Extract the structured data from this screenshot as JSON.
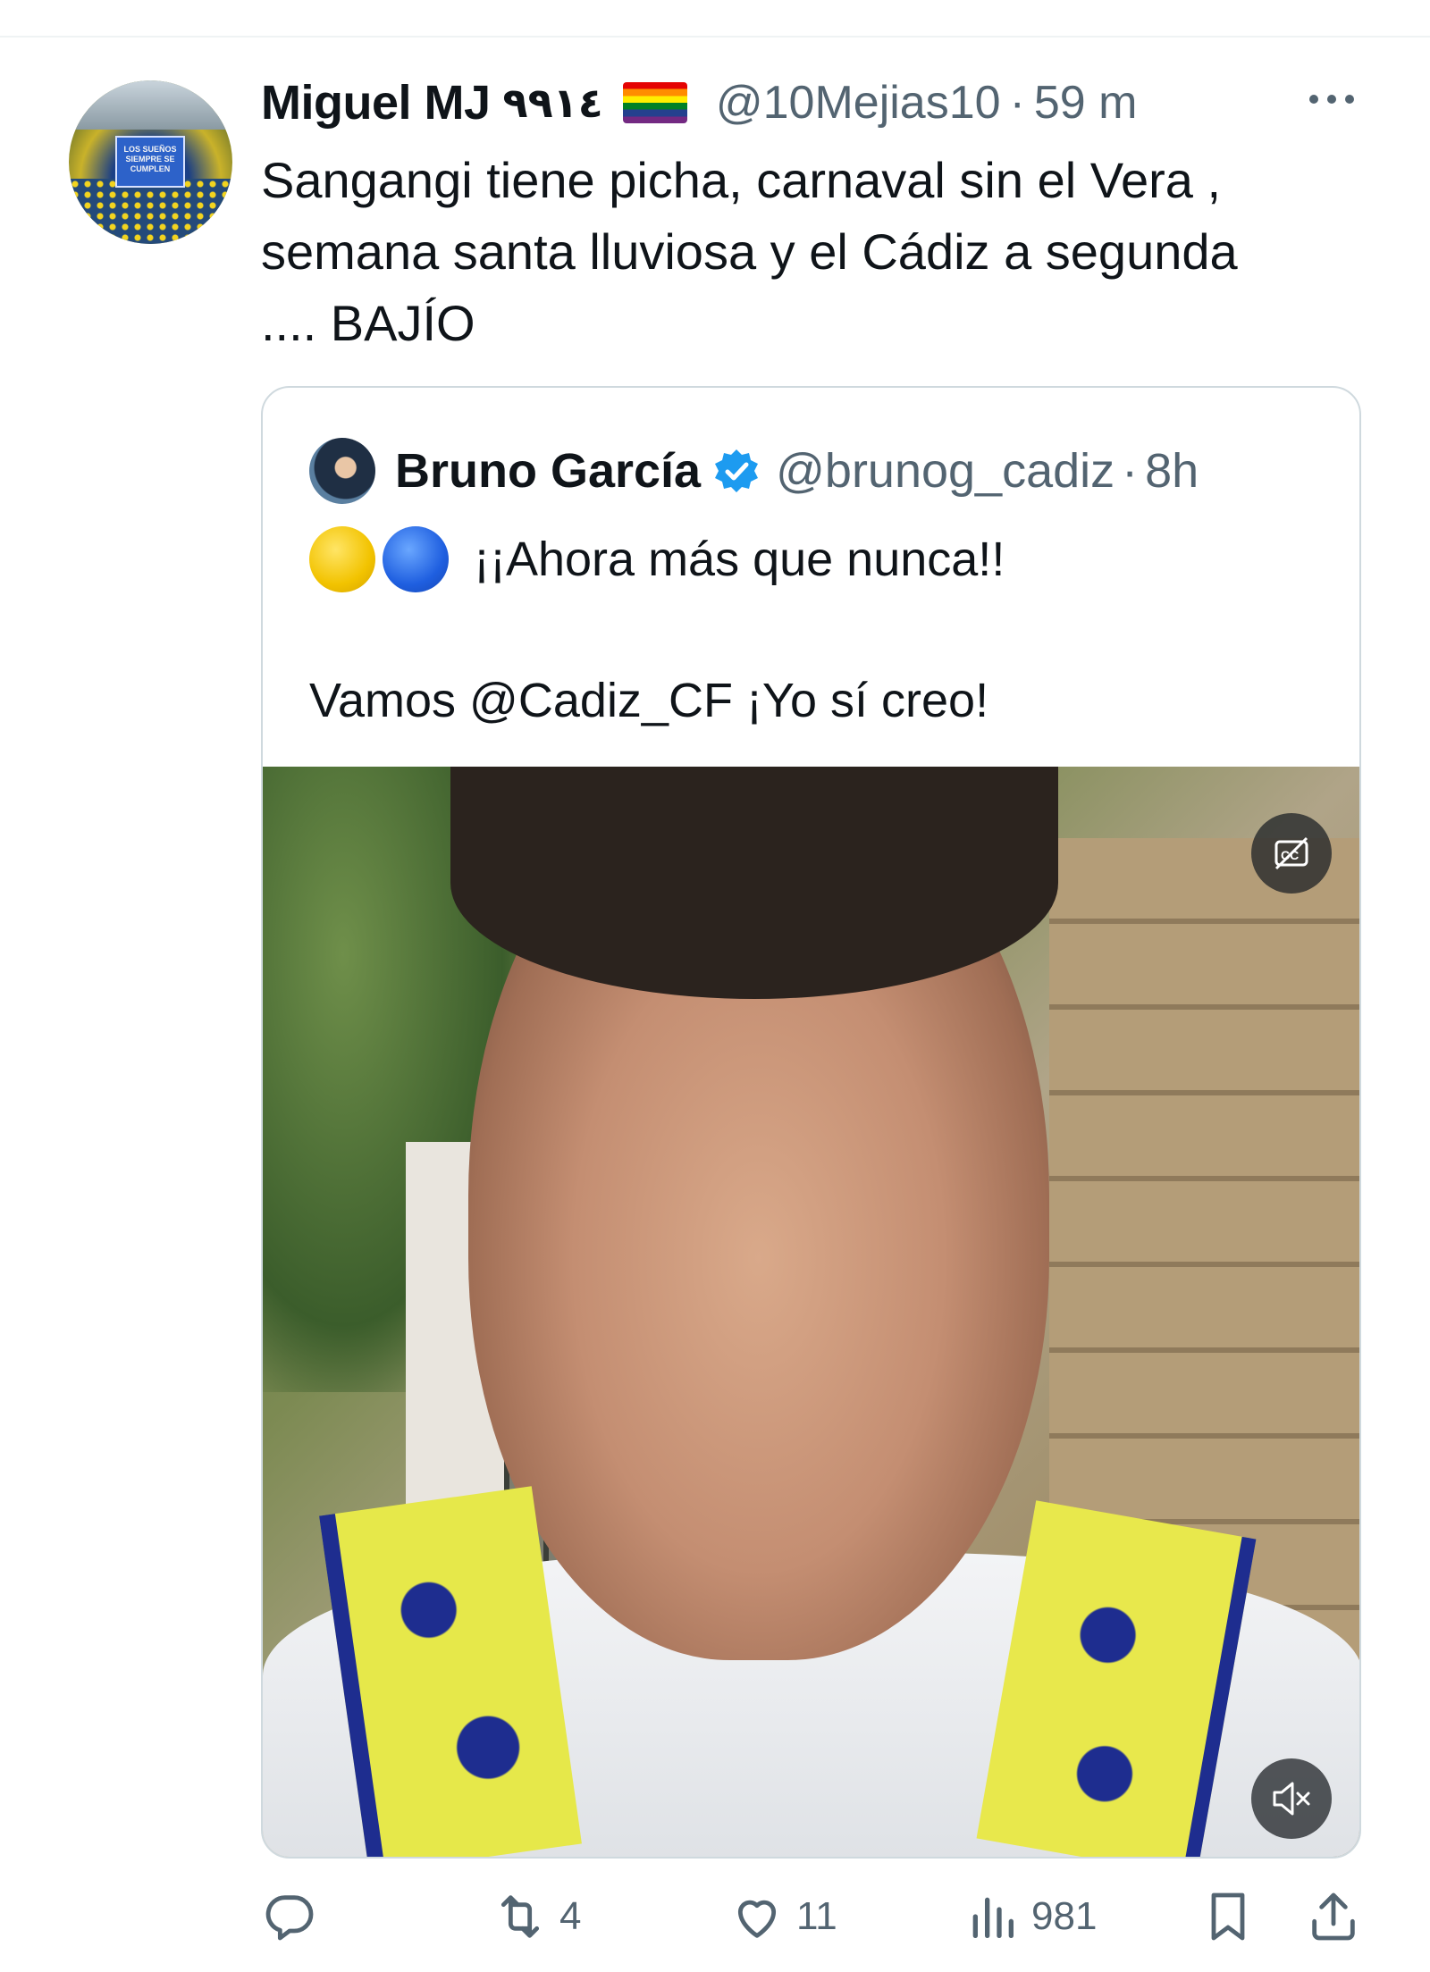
{
  "post": {
    "display_name": "Miguel MJ",
    "name_suffix": "٩٩١٤",
    "flag_icon": "rainbow-flag-icon",
    "handle": "@10Mejias10",
    "separator": "·",
    "time": "59 m",
    "more_icon": "more-icon",
    "text": "Sangangi tiene picha, carnaval sin el Vera ,\nsemana santa lluviosa y el Cádiz a segunda\n.... BAJÍO",
    "avatar_banner_text": "LOS SUEÑOS SIEMPRE SE CUMPLEN"
  },
  "quote": {
    "display_name": "Bruno García",
    "verified_icon": "verified-badge-icon",
    "handle": "@brunog_cadiz",
    "separator": "·",
    "time": "8h",
    "line1_text": "¡¡Ahora más que nunca!!",
    "line2_text": "Vamos @Cadiz_CF  ¡Yo sí creo!",
    "emoji_1": "yellow-circle-emoji",
    "emoji_2": "blue-circle-emoji",
    "media": {
      "captions_icon": "captions-off-icon",
      "mute_icon": "muted-speaker-icon"
    }
  },
  "actions": {
    "reply_count": "",
    "repost_count": "4",
    "like_count": "11",
    "views_count": "981"
  },
  "colors": {
    "text_primary": "#0f1419",
    "text_secondary": "#536471",
    "border": "#cfd9de",
    "verified_blue": "#1d9bf0"
  }
}
